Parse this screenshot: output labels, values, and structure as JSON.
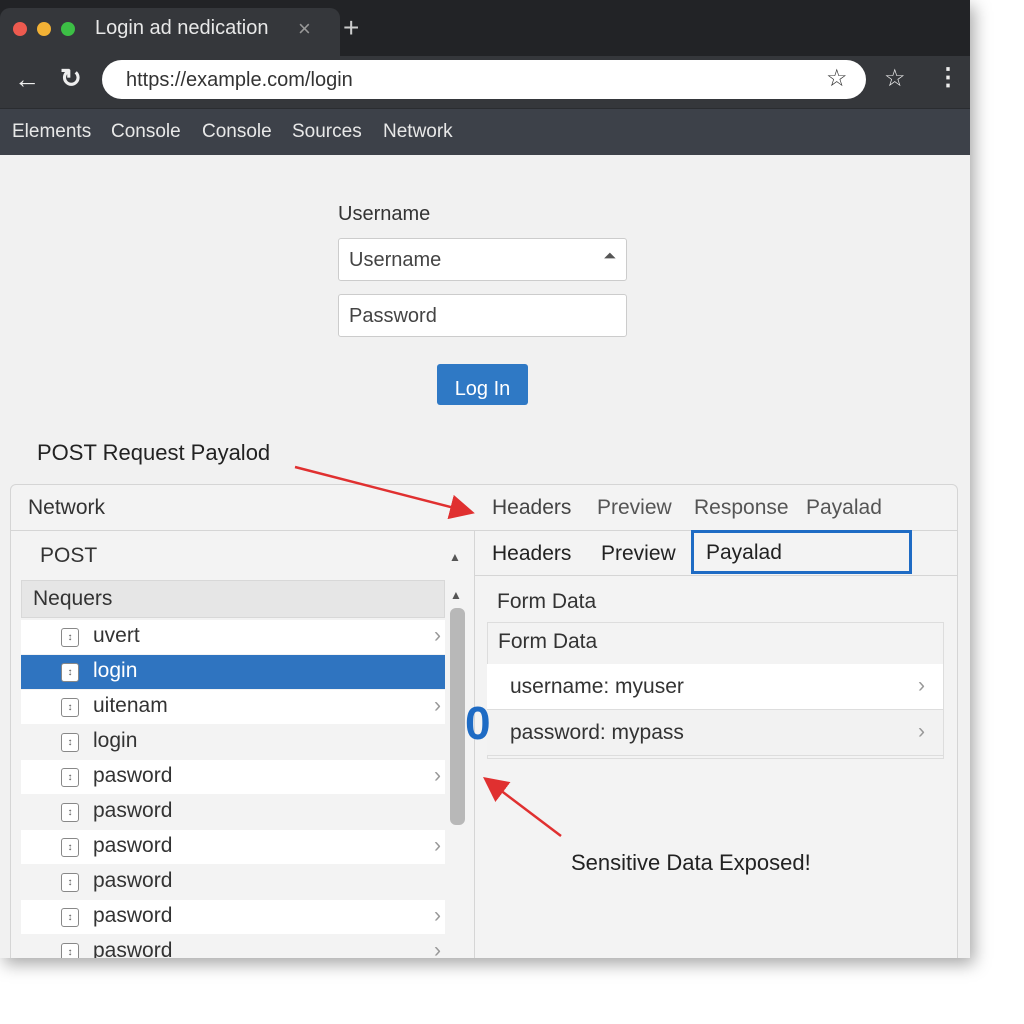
{
  "browser": {
    "tab_title": "Login ad nedication",
    "close": "×",
    "new_tab": "+",
    "url": "https://example.com/login",
    "back": "←",
    "reload": "↻",
    "star": "☆",
    "menu": "⋮"
  },
  "devtools_tabs": [
    "Elements",
    "Console",
    "Console",
    "Sources",
    "Network"
  ],
  "form": {
    "label": "Username",
    "username_placeholder": "Username",
    "password_placeholder": "Password",
    "button": "Log In",
    "username_icon": "⏶"
  },
  "annotations": {
    "post_label": "POST Request Payalod",
    "sensitive": "Sensitive Data Exposed!",
    "marker": "0",
    "colors": {
      "arrow": "#e03030",
      "highlight": "#1e6bc4"
    }
  },
  "network": {
    "title": "Network",
    "method": "POST",
    "list_header": "Nequers",
    "rows": [
      {
        "name": "uvert",
        "chev": true
      },
      {
        "name": "login",
        "chev": false,
        "selected": true
      },
      {
        "name": "uitenam",
        "chev": true
      },
      {
        "name": "login",
        "chev": false
      },
      {
        "name": "pasword",
        "chev": true
      },
      {
        "name": "pasword",
        "chev": false
      },
      {
        "name": "pasword",
        "chev": true
      },
      {
        "name": "pasword",
        "chev": false
      },
      {
        "name": "pasword",
        "chev": true
      },
      {
        "name": "pasword",
        "chev": true
      }
    ],
    "tabs1": [
      "Headers",
      "Preview",
      "Response",
      "Payalad"
    ],
    "tabs2": [
      "Headers",
      "Preview",
      "Payalad"
    ],
    "form_data_title": "Form Data",
    "form_data_header": "Form Data",
    "fields": [
      "username: myuser",
      "password: mypass"
    ]
  }
}
